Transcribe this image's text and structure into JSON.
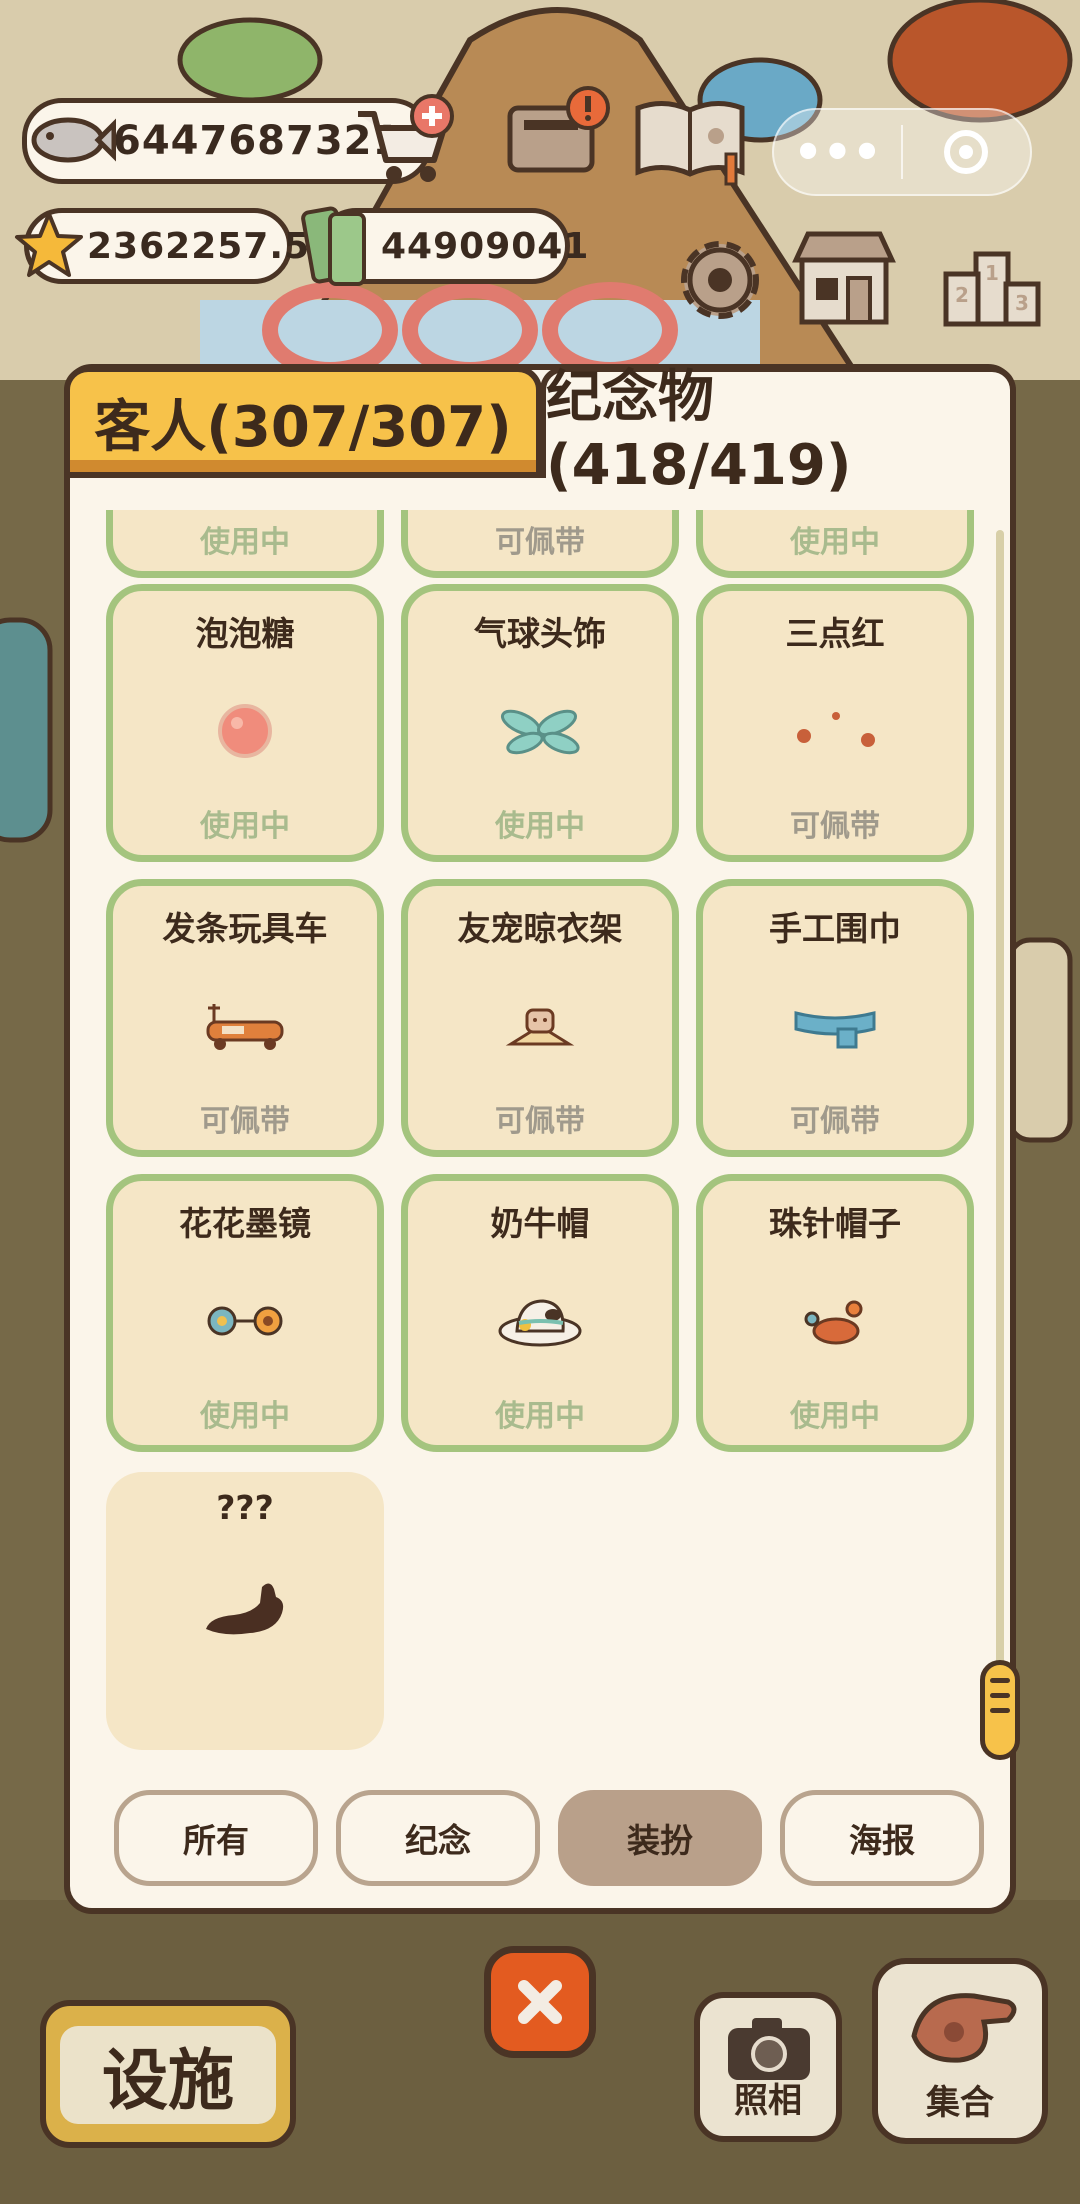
{
  "currencies": {
    "fish": "6447687321",
    "stars": "2362257.5",
    "tickets": "44909041"
  },
  "tabs": {
    "guests": "客人(307/307)",
    "souvenirs": "纪念物(418/419)"
  },
  "partial_row": [
    {
      "status": "使用中",
      "status_type": "in-use"
    },
    {
      "status": "可佩带",
      "status_type": "wearable"
    },
    {
      "status": "使用中",
      "status_type": "in-use"
    }
  ],
  "items": [
    {
      "name": "泡泡糖",
      "status": "使用中",
      "status_type": "in-use",
      "icon": "bubble-gum-icon"
    },
    {
      "name": "气球头饰",
      "status": "使用中",
      "status_type": "in-use",
      "icon": "balloon-headpiece-icon"
    },
    {
      "name": "三点红",
      "status": "可佩带",
      "status_type": "wearable",
      "icon": "three-red-dots-icon"
    },
    {
      "name": "发条玩具车",
      "status": "可佩带",
      "status_type": "wearable",
      "icon": "windup-toy-car-icon"
    },
    {
      "name": "友宠晾衣架",
      "status": "可佩带",
      "status_type": "wearable",
      "icon": "pet-clothes-rack-icon"
    },
    {
      "name": "手工围巾",
      "status": "可佩带",
      "status_type": "wearable",
      "icon": "handmade-scarf-icon"
    },
    {
      "name": "花花墨镜",
      "status": "使用中",
      "status_type": "in-use",
      "icon": "flower-sunglasses-icon"
    },
    {
      "name": "奶牛帽",
      "status": "使用中",
      "status_type": "in-use",
      "icon": "cow-hat-icon"
    },
    {
      "name": "珠针帽子",
      "status": "使用中",
      "status_type": "in-use",
      "icon": "pin-hat-icon"
    },
    {
      "name": "???",
      "status": "",
      "status_type": "locked",
      "icon": "unknown-silhouette-icon"
    }
  ],
  "filters": [
    "所有",
    "纪念",
    "装扮",
    "海报"
  ],
  "active_filter": "装扮",
  "bottom": {
    "facility": "设施",
    "photo": "照相",
    "gather": "集合"
  },
  "colors": {
    "accent_yellow": "#f7c24a",
    "card_border": "#a4c47e",
    "in_use_text": "#a9bb8e",
    "wearable_text": "#a09a8c",
    "close_orange": "#e35b20"
  }
}
